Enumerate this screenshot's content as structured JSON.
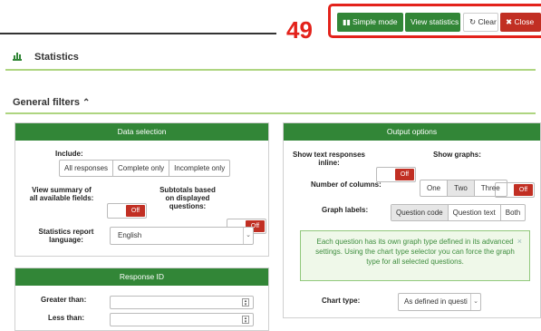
{
  "annotation": {
    "number": "49"
  },
  "toolbar": {
    "simple_mode": "Simple mode",
    "view_statistics": "View statistics",
    "clear": "Clear",
    "close": "Close"
  },
  "page": {
    "title": "Statistics"
  },
  "filters": {
    "title": "General filters",
    "collapse_glyph": "⌃"
  },
  "data_selection": {
    "heading": "Data selection",
    "include_label": "Include:",
    "include_options": [
      "All responses",
      "Complete only",
      "Incomplete only"
    ],
    "view_summary_label": "View summary of all available fields:",
    "view_summary_toggle": "Off",
    "subtotals_label": "Subtotals based on displayed questions:",
    "subtotals_toggle": "Off",
    "language_label": "Statistics report language:",
    "language_value": "English"
  },
  "response_id": {
    "heading": "Response ID",
    "greater_than": "Greater than:",
    "less_than": "Less than:"
  },
  "output_options": {
    "heading": "Output options",
    "show_text_label": "Show text responses inline:",
    "show_text_toggle": "Off",
    "show_graphs_label": "Show graphs:",
    "show_graphs_toggle": "Off",
    "columns_label": "Number of columns:",
    "columns_options": [
      "One",
      "Two",
      "Three"
    ],
    "graph_labels_label": "Graph labels:",
    "graph_labels_options": [
      "Question code",
      "Question text",
      "Both"
    ],
    "info_text": "Each question has its own graph type defined in its advanced settings. Using the chart type selector you can force the graph type for all selected questions.",
    "chart_type_label": "Chart type:",
    "chart_type_value": "As defined in questi"
  }
}
